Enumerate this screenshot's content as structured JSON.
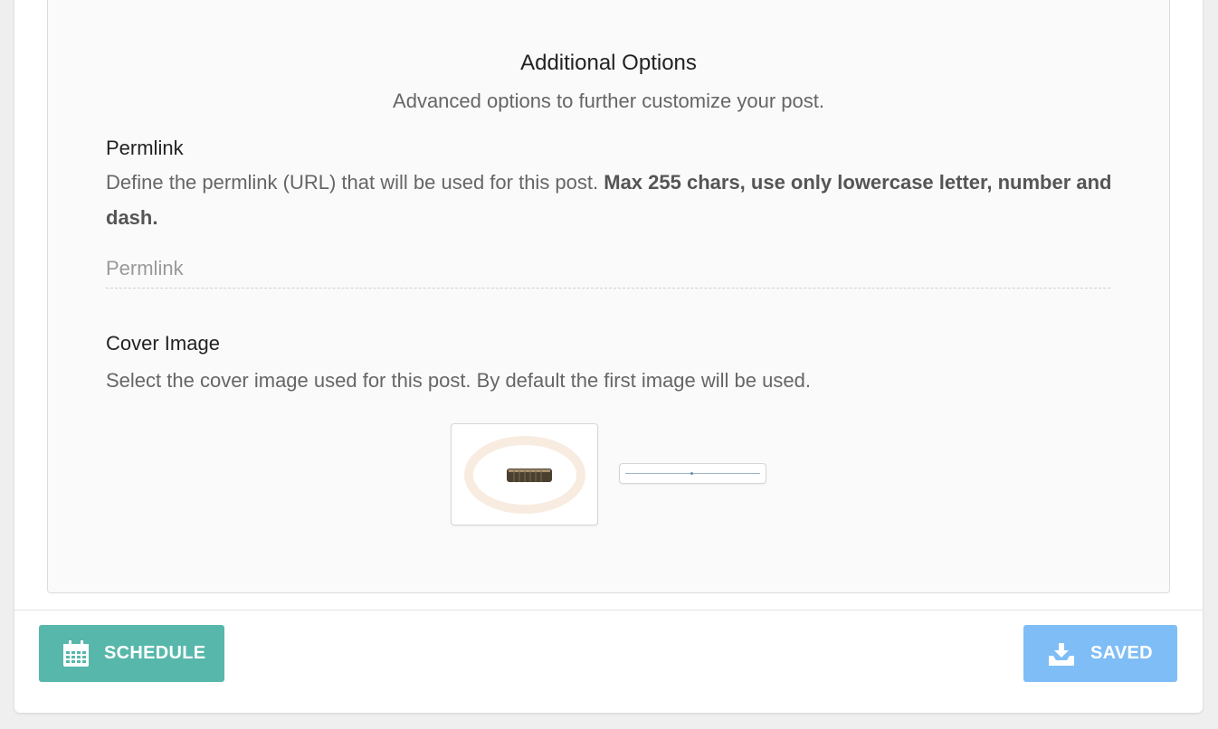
{
  "section": {
    "title": "Additional Options",
    "subtitle": "Advanced options to further customize your post."
  },
  "permlink": {
    "label": "Permlink",
    "description_plain": "Define the permlink (URL) that will be used for this post.",
    "description_bold": "Max 255 chars, use only lowercase letter, number and dash.",
    "input_value": "",
    "input_placeholder": "Permlink"
  },
  "cover_image": {
    "label": "Cover Image",
    "description": "Select the cover image used for this post. By default the first image will be used.",
    "thumbnails": [
      {
        "name": "cover-thumbnail-1",
        "icon": "watermark-bolt-image"
      },
      {
        "name": "cover-thumbnail-2",
        "icon": "thin-line-image"
      }
    ]
  },
  "footer": {
    "schedule_label": "SCHEDULE",
    "schedule_icon": "calendar-icon",
    "saved_label": "SAVED",
    "saved_icon": "inbox-download-icon"
  },
  "colors": {
    "schedule_button": "#57b7ab",
    "saved_button": "#7fbdf6"
  }
}
